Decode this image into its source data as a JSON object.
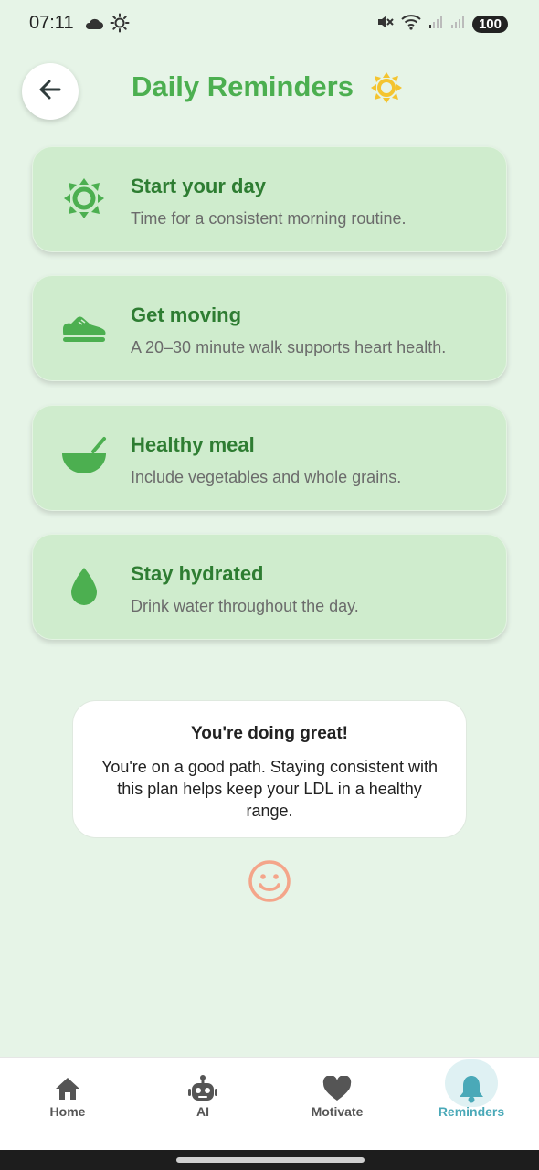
{
  "status_bar": {
    "time": "07:11",
    "left_icons": [
      "cloud-icon",
      "sun-icon"
    ],
    "right_icons": [
      "mute-icon",
      "wifi-icon",
      "signal-icon",
      "signal-icon"
    ],
    "battery": "100"
  },
  "header": {
    "title": "Daily Reminders",
    "back_icon": "arrow-left-icon",
    "title_icon": "sun-icon",
    "title_color": "#4caf50",
    "sun_color": "#f4c430"
  },
  "reminders": [
    {
      "icon": "sun-icon",
      "title": "Start your day",
      "description": "Time for a consistent morning routine."
    },
    {
      "icon": "sneaker-icon",
      "title": "Get moving",
      "description": "A 20–30 minute walk supports heart health."
    },
    {
      "icon": "bowl-icon",
      "title": "Healthy meal",
      "description": "Include vegetables and whole grains."
    },
    {
      "icon": "water-drop-icon",
      "title": "Stay hydrated",
      "description": "Drink water throughout the day."
    }
  ],
  "encouragement": {
    "title": "You're doing great!",
    "body": "You're on a good path. Staying consistent with this plan helps keep your LDL in a healthy range.",
    "icon": "smile-icon",
    "icon_color": "#f4a58a"
  },
  "bottom_nav": {
    "items": [
      {
        "label": "Home",
        "icon": "home-icon"
      },
      {
        "label": "AI",
        "icon": "robot-icon"
      },
      {
        "label": "Motivate",
        "icon": "heart-icon"
      },
      {
        "label": "Reminders",
        "icon": "bell-icon"
      }
    ],
    "active": "Reminders",
    "active_color": "#4aa9b8"
  },
  "colors": {
    "background": "#e6f4e7",
    "card": "#cfeccd",
    "card_title": "#2e7d32",
    "icon_green": "#4caf50"
  }
}
